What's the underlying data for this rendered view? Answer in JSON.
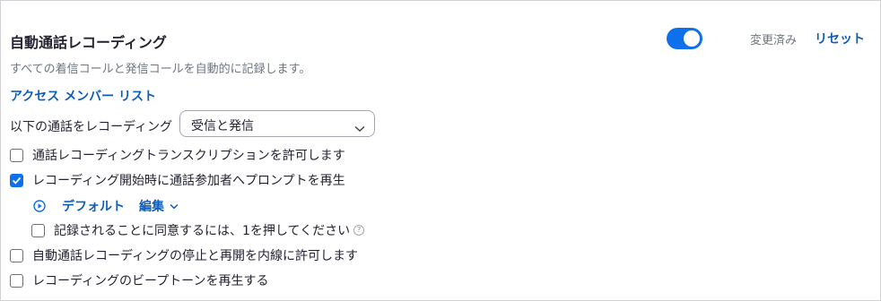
{
  "section": {
    "title": "自動通話レコーディング",
    "description": "すべての着信コールと発信コールを自動的に記録します。",
    "status_text": "変更済み",
    "reset_label": "リセット",
    "toggle_on": true
  },
  "access_link": "アクセス メンバー リスト",
  "record_select": {
    "label": "以下の通話をレコーディング",
    "value": "受信と発信"
  },
  "options": [
    {
      "label": "通話レコーディングトランスクリプションを許可します",
      "checked": false
    },
    {
      "label": "レコーディング開始時に通話参加者へプロンプトを再生",
      "checked": true
    },
    {
      "label": "自動通話レコーディングの停止と再開を内線に許可します",
      "checked": false
    },
    {
      "label": "レコーディングのビープトーンを再生する",
      "checked": false
    }
  ],
  "prompt_controls": {
    "default_label": "デフォルト",
    "edit_label": "編集"
  },
  "consent_option": {
    "label": "記録されることに同意するには、1を押してください",
    "checked": false,
    "help_glyph": "?"
  },
  "colors": {
    "accent": "#0e71eb",
    "link": "#0e5eb7",
    "muted": "#6e7680"
  }
}
